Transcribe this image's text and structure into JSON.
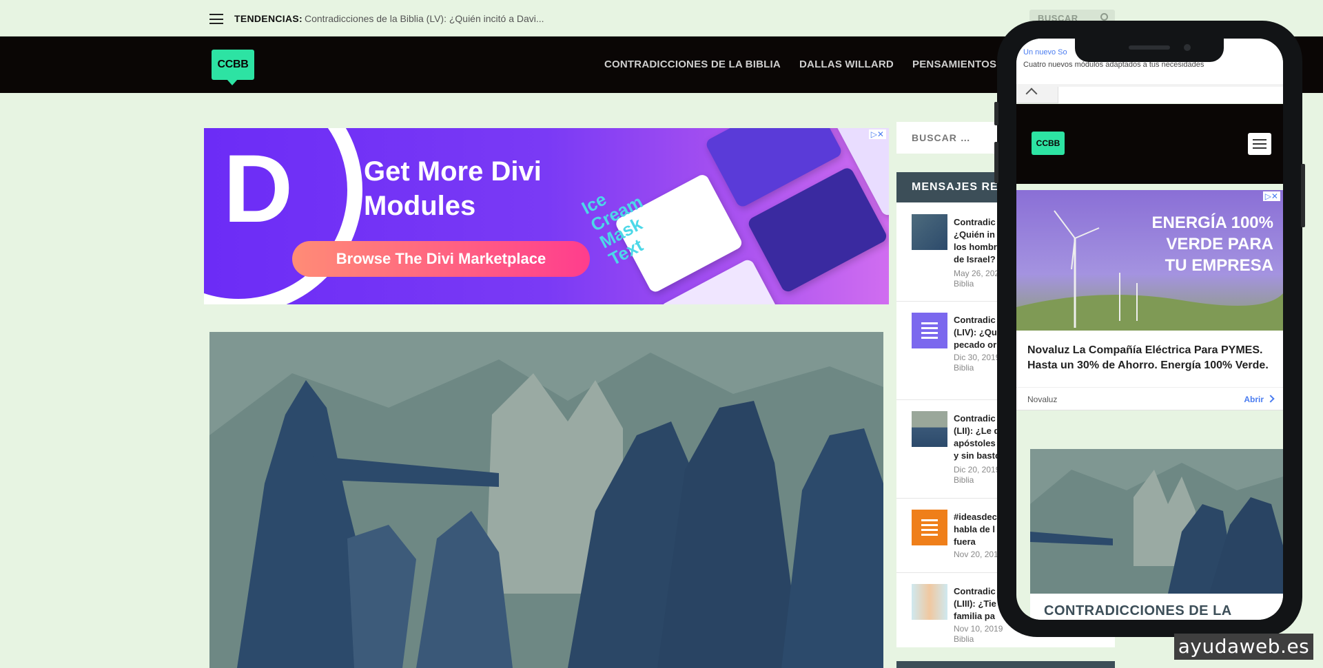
{
  "topbar": {
    "trending_label": "TENDENCIAS:",
    "trending_text": "Contradicciones de la Biblia (LV): ¿Quién incitó a Davi...",
    "search_placeholder": "BUSCAR"
  },
  "nav": {
    "logo": "CCBB",
    "items": [
      "CONTRADICCIONES DE LA BIBLIA",
      "DALLAS WILLARD",
      "PENSAMIENTOS"
    ]
  },
  "ad_main": {
    "letter": "D",
    "headline": "Get More Divi\nModules",
    "cta": "Browse The Divi Marketplace",
    "card_text": "Ice\nCream\nMask\nText",
    "adchoices": "▷✕"
  },
  "sidebar": {
    "search_placeholder": "BUSCAR …",
    "recent_heading": "MENSAJES RE",
    "posts": [
      {
        "title": "Contradic\n¿Quién in\nlos hombr\nde Israel?",
        "meta": "May 26, 202\nBiblia"
      },
      {
        "title": "Contradic\n(LIV): ¿Qu\npecado or",
        "meta": "Dic 30, 2019\nBiblia"
      },
      {
        "title": "Contradic\n(LII): ¿Le d\napóstoles\ny sin basto",
        "meta": "Dic 20, 2019\nBiblia"
      },
      {
        "title": "#ideasdec\nhabla de l\nfuera",
        "meta": "Nov 20, 2019"
      },
      {
        "title": "Contradic\n(LIII): ¿Tie\nfamilia pa",
        "meta": "Nov 10, 2019\nBiblia"
      }
    ]
  },
  "phone": {
    "banner_title": "Un nuevo So",
    "banner_text": "Cuatro nuevos módulos adaptados a tus necesidades",
    "logo": "CCBB",
    "ad_headline": "ENERGÍA 100%\nVERDE PARA\nTU EMPRESA",
    "ad_body": "Novaluz La Compañía Eléctrica Para PYMES. Hasta un 30% de Ahorro. Energía 100% Verde.",
    "ad_advertiser": "Novaluz",
    "ad_cta": "Abrir",
    "adchoices": "▷✕",
    "post_title": "CONTRADICCIONES DE LA"
  },
  "watermark": "ayudaweb.es",
  "colors": {
    "page_bg": "#e7f4e2",
    "nav_bg": "#0a0605",
    "logo_accent": "#2de3a3",
    "sidebar_heading_bg": "#3c4e58",
    "ad_purple": "#6c2cf6",
    "thumb_purple": "#7b68ee",
    "thumb_orange": "#ef7f1a"
  }
}
